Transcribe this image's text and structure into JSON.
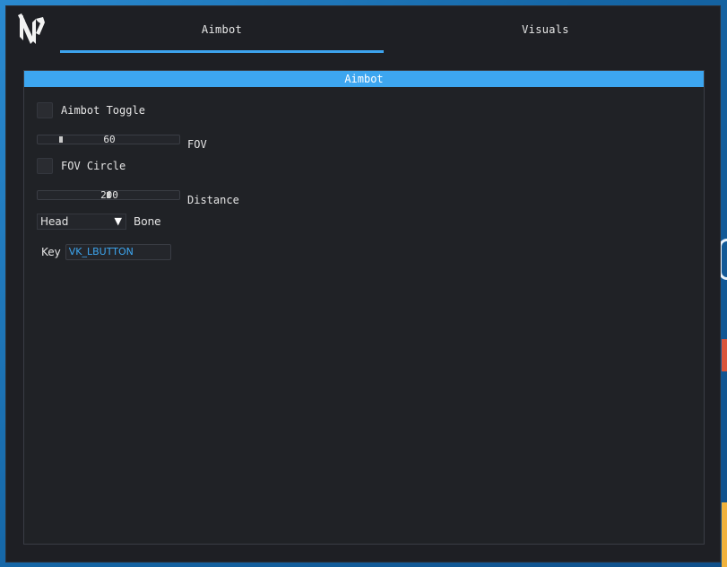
{
  "tabs": [
    {
      "label": "Aimbot",
      "active": true
    },
    {
      "label": "Visuals",
      "active": false
    }
  ],
  "panel": {
    "title": "Aimbot"
  },
  "aimbot_toggle": {
    "label": "Aimbot Toggle",
    "checked": false
  },
  "fov": {
    "label": "FOV",
    "value": "60"
  },
  "fov_circle": {
    "label": "FOV Circle",
    "checked": false
  },
  "distance": {
    "label": "Distance",
    "value": "200"
  },
  "bone": {
    "label": "Bone",
    "selected": "Head",
    "arrow_icon": "triangle-down-icon"
  },
  "key": {
    "label": "Key",
    "value": "VK_LBUTTON"
  },
  "colors": {
    "accent": "#3da6f0",
    "window_bg": "#1e1f24",
    "text": "#e6e6e6"
  },
  "logo": {
    "icon": "app-logo-icon"
  }
}
